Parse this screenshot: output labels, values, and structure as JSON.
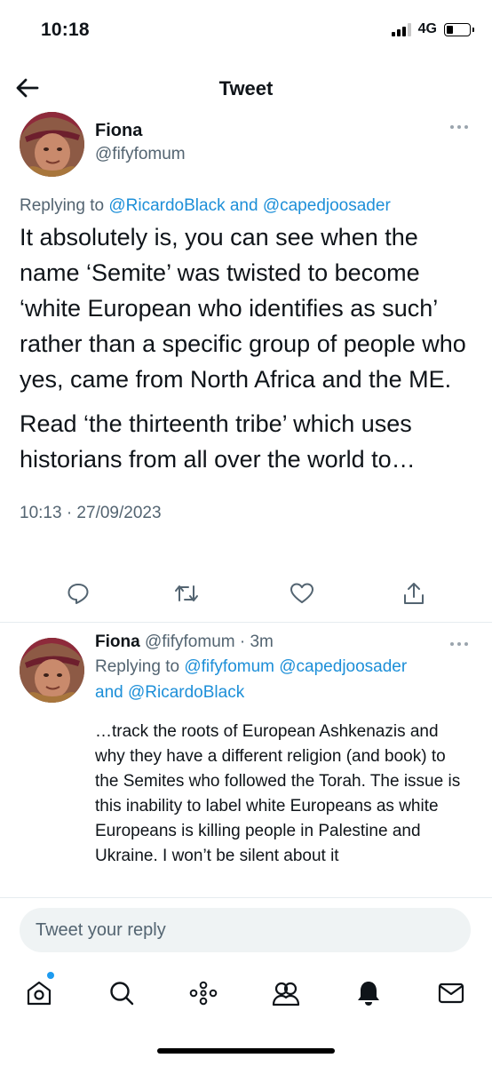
{
  "status_bar": {
    "time": "10:18",
    "network": "4G"
  },
  "nav": {
    "title": "Tweet"
  },
  "tweet": {
    "author_name": "Fiona",
    "author_handle": "@fifyfomum",
    "replying_prefix": "Replying to ",
    "replying_user_1": "@RicardoBlack",
    "replying_and": " and ",
    "replying_user_2": "@capedjoosader",
    "paragraph_1": "It absolutely is, you can see when the name ‘Semite’ was twisted to become ‘white European who identifies as such’ rather than a specific group of people who yes, came from North Africa and the ME.",
    "paragraph_2": "Read ‘the thirteenth tribe’ which uses historians from all over the world to…",
    "timestamp": "10:13 · 27/09/2023"
  },
  "reply": {
    "author_name": "Fiona",
    "author_handle": " @fifyfomum",
    "age": " · 3m",
    "replying_prefix": "Replying to ",
    "replying_user_1": "@fifyfomum",
    "replying_user_2": " @capedjoosader",
    "replying_and": "and ",
    "replying_user_3": "@RicardoBlack",
    "body": "…track the roots of European Ashkenazis and why they have a different religion (and book) to the Semites who followed the Torah. The issue is this inability to label white Europeans as white Europeans is killing people in Palestine and Ukraine. I won’t be silent about it"
  },
  "compose": {
    "placeholder": "Tweet your reply"
  },
  "colors": {
    "link": "#1d8fd8",
    "secondary_text": "#536471",
    "accent_dot": "#1d9bf0"
  },
  "icons": {
    "back": "arrow-left-icon",
    "more": "more-horizontal-icon",
    "reply": "reply-icon",
    "retweet": "retweet-icon",
    "like": "heart-icon",
    "share": "share-icon",
    "tab_home": "home-icon",
    "tab_search": "search-icon",
    "tab_spaces": "spaces-icon",
    "tab_communities": "communities-icon",
    "tab_notifications": "bell-icon",
    "tab_messages": "envelope-icon"
  }
}
